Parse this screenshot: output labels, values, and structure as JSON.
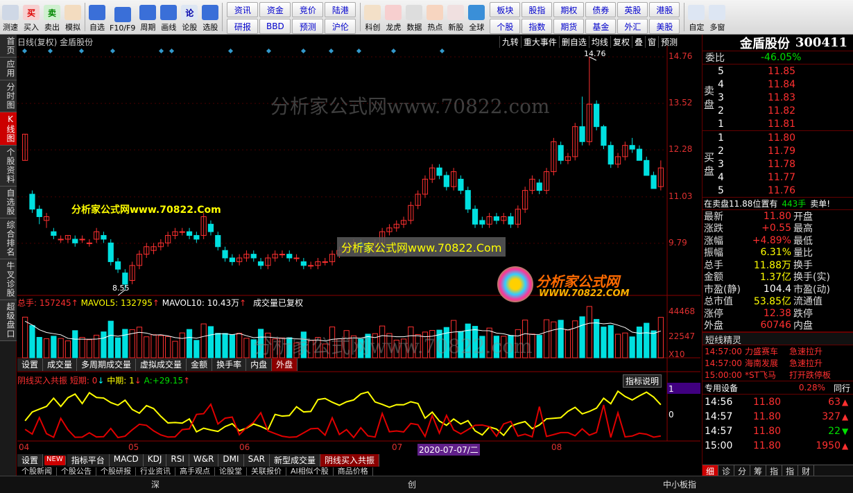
{
  "toolbar": {
    "left_buttons": [
      {
        "label": "测速",
        "icon": "clock-icon"
      },
      {
        "label": "买入",
        "icon": "buy-icon",
        "glyph": "买"
      },
      {
        "label": "卖出",
        "icon": "sell-icon",
        "glyph": "卖"
      },
      {
        "label": "模拟",
        "icon": "hammer-icon"
      },
      {
        "label": "自选",
        "icon": "star-icon"
      },
      {
        "label": "F10/F9",
        "icon": "f10-icon"
      },
      {
        "label": "周期",
        "icon": "period-icon"
      },
      {
        "label": "画线",
        "icon": "pen-icon"
      },
      {
        "label": "论股",
        "icon": "discuss-icon",
        "glyph": "论"
      },
      {
        "label": "选股",
        "icon": "select-stock-icon"
      }
    ],
    "grid1": [
      "资讯",
      "资金",
      "竞价",
      "陆港",
      "研报",
      "BBD",
      "预测",
      "沪伦"
    ],
    "mid_buttons": [
      {
        "label": "科创",
        "icon": "science-icon"
      },
      {
        "label": "龙虎",
        "icon": "dragon-tiger-icon"
      },
      {
        "label": "数据",
        "icon": "pe-data-icon"
      },
      {
        "label": "热点",
        "icon": "hot-icon"
      },
      {
        "label": "新股",
        "icon": "new-stock-icon"
      },
      {
        "label": "全球",
        "icon": "globe-icon"
      }
    ],
    "grid2": [
      "板块",
      "股指",
      "期权",
      "债券",
      "英股",
      "港股",
      "个股",
      "指数",
      "期货",
      "基金",
      "外汇",
      "美股"
    ],
    "right_buttons": [
      {
        "label": "自定",
        "icon": "custom-icon"
      },
      {
        "label": "多窗",
        "icon": "multi-window-icon"
      }
    ]
  },
  "left_tabs": [
    {
      "label": "首页",
      "active": false
    },
    {
      "label": "应用",
      "active": false
    },
    {
      "label": "分时图",
      "active": false
    },
    {
      "label": "K线图",
      "active": true
    },
    {
      "label": "个股资料",
      "active": false
    },
    {
      "label": "自选股",
      "active": false
    },
    {
      "label": "综合排名",
      "active": false
    },
    {
      "label": "牛叉诊股",
      "active": false
    },
    {
      "label": "超级盘口",
      "active": false
    }
  ],
  "main": {
    "header": "日线(复权) 金盾股份",
    "tools": [
      "九转",
      "重大事件",
      "删自选",
      "均线",
      "复权",
      "叠",
      "窗",
      "预测"
    ],
    "y_ticks": [
      "14.76",
      "13.52",
      "12.28",
      "11.03",
      "9.79"
    ],
    "high_label": "14.76",
    "low_label": "8.55",
    "watermark": "分析家公式网www.70822.com",
    "yellow_tag": "分析家公式网www.70822.Com",
    "box_tag": "分析家公式网www.70822.Com",
    "logo_cn": "分析家公式网",
    "logo_en": "WWW.70822.COM"
  },
  "volume": {
    "header_total_label": "总手:",
    "header_total": "157245",
    "header_ma5_label": "MAVOL5:",
    "header_ma5": "132795",
    "header_ma10_label": "MAVOL10:",
    "header_ma10": "10.43万",
    "header_note": "成交量已复权",
    "y_ticks": [
      "44468",
      "22547",
      "X10"
    ],
    "tabs": [
      "设置",
      "成交量",
      "多周期成交量",
      "虚拟成交量",
      "金额",
      "换手率",
      "内盘",
      "外盘"
    ],
    "active_tab": "外盘"
  },
  "indicator": {
    "name": "阴线买入共振",
    "short_label": "短期:",
    "short_val": "0",
    "mid_label": "中期:",
    "mid_val": "1",
    "a_label": "A:",
    "a_val": "+29.15",
    "btn": "指标说明",
    "y_ticks": [
      "1",
      "0"
    ]
  },
  "dates": {
    "labels": [
      "04",
      "05",
      "06",
      "07",
      "08"
    ],
    "cursor": "2020-07-07/二"
  },
  "bottom_tabs": [
    "设置",
    "指标平台",
    "MACD",
    "KDJ",
    "RSI",
    "W&R",
    "DMI",
    "SAR",
    "新型成交量",
    "阴线买入共振"
  ],
  "bottom_tabs_new_badge": "NEW",
  "news_tabs": [
    "个股新闻",
    "个股公告",
    "个股研报",
    "行业资讯",
    "高手观点",
    "论股堂",
    "关联报价",
    "AI相似个股",
    "商品价格"
  ],
  "status": {
    "left": "深",
    "mid": "创",
    "right": "中小板指"
  },
  "stock": {
    "name": "金盾股份",
    "code": "300411",
    "weibi_label": "委比",
    "weibi": "-46.05%",
    "sell_label": "卖盘",
    "buy_label": "买盘",
    "asks": [
      {
        "n": "5",
        "p": "11.85"
      },
      {
        "n": "4",
        "p": "11.84"
      },
      {
        "n": "3",
        "p": "11.83"
      },
      {
        "n": "2",
        "p": "11.82"
      },
      {
        "n": "1",
        "p": "11.81"
      }
    ],
    "bids": [
      {
        "n": "1",
        "p": "11.80"
      },
      {
        "n": "2",
        "p": "11.79"
      },
      {
        "n": "3",
        "p": "11.78"
      },
      {
        "n": "4",
        "p": "11.77"
      },
      {
        "n": "5",
        "p": "11.76"
      }
    ],
    "trade_note_prefix": "在卖盘11.88位置有",
    "trade_note_vol": "443手",
    "trade_note_suffix": "卖单!",
    "quotes": [
      {
        "k": "最新",
        "v": "11.80",
        "k2": "开盘",
        "c": "red"
      },
      {
        "k": "涨跌",
        "v": "+0.55",
        "k2": "最高",
        "c": "red"
      },
      {
        "k": "涨幅",
        "v": "+4.89%",
        "k2": "最低",
        "c": "red"
      },
      {
        "k": "振幅",
        "v": "6.31%",
        "k2": "量比",
        "c": "yel"
      },
      {
        "k": "总手",
        "v": "11.88万",
        "k2": "换手",
        "c": "yel"
      },
      {
        "k": "金额",
        "v": "1.37亿",
        "k2": "换手(实)",
        "c": "yel"
      },
      {
        "k": "市盈(静)",
        "v": "104.4",
        "k2": "市盈(动)",
        "c": "wht"
      },
      {
        "k": "总市值",
        "v": "53.85亿",
        "k2": "流通值",
        "c": "yel"
      },
      {
        "k": "涨停",
        "v": "12.38",
        "k2": "跌停",
        "c": "red"
      },
      {
        "k": "外盘",
        "v": "60746",
        "k2": "内盘",
        "c": "red"
      }
    ],
    "sprite_title": "短线精灵",
    "sprites": [
      {
        "t": "14:57:00",
        "n": "力盛赛车",
        "e": "急速拉升"
      },
      {
        "t": "14:57:00",
        "n": "海南发展",
        "e": "急速拉升"
      },
      {
        "t": "15:00:00",
        "n": "*ST飞马",
        "e": "打开跌停板"
      }
    ],
    "device_label": "专用设备",
    "device_pct": "0.28%",
    "device_more": "同行",
    "deals": [
      {
        "t": "14:56",
        "p": "11.80",
        "v": "63",
        "dir": "up"
      },
      {
        "t": "14:57",
        "p": "11.80",
        "v": "327",
        "dir": "up"
      },
      {
        "t": "14:57",
        "p": "11.80",
        "v": "22",
        "dir": "down"
      },
      {
        "t": "15:00",
        "p": "11.80",
        "v": "1950",
        "dir": "up"
      }
    ],
    "bottom_tabs": [
      "细",
      "诊",
      "分",
      "筹",
      "指",
      "指",
      "财"
    ]
  },
  "colors": {
    "up": "#ff3030",
    "down": "#00e0e0",
    "ma": "#ffffff",
    "yellow": "#ffff00",
    "bg": "#000000"
  },
  "chart_data": {
    "type": "candlestick",
    "title": "日线(复权) 金盾股份",
    "price_range": [
      8.55,
      14.76
    ],
    "candles": [
      [
        12.0,
        12.7,
        12.0,
        12.7
      ],
      [
        11.1,
        11.2,
        10.6,
        10.7
      ],
      [
        10.7,
        10.8,
        10.3,
        10.5
      ],
      [
        10.4,
        10.6,
        10.2,
        10.5
      ],
      [
        10.1,
        10.2,
        9.9,
        10.0
      ],
      [
        9.9,
        10.0,
        9.8,
        9.9
      ],
      [
        9.9,
        10.0,
        9.8,
        10.0
      ],
      [
        9.9,
        10.0,
        9.7,
        9.8
      ],
      [
        9.9,
        10.0,
        9.8,
        9.9
      ],
      [
        9.8,
        9.9,
        9.7,
        9.8
      ],
      [
        9.9,
        10.2,
        9.8,
        10.1
      ],
      [
        10.0,
        10.1,
        9.8,
        9.9
      ],
      [
        9.8,
        9.9,
        9.2,
        9.3
      ],
      [
        9.3,
        9.4,
        9.0,
        9.1
      ],
      [
        9.0,
        9.1,
        8.55,
        8.7
      ],
      [
        8.8,
        9.3,
        8.7,
        9.2
      ],
      [
        9.2,
        9.6,
        9.1,
        9.5
      ],
      [
        9.5,
        9.8,
        9.4,
        9.7
      ],
      [
        9.6,
        9.8,
        9.5,
        9.7
      ],
      [
        9.7,
        9.9,
        9.6,
        9.8
      ],
      [
        9.8,
        10.1,
        9.7,
        10.0
      ],
      [
        10.0,
        10.2,
        9.9,
        10.1
      ],
      [
        10.1,
        10.2,
        10.0,
        10.1
      ],
      [
        10.1,
        10.2,
        9.9,
        10.0
      ],
      [
        10.0,
        10.1,
        9.8,
        9.9
      ],
      [
        10.0,
        10.6,
        9.9,
        10.5
      ],
      [
        10.3,
        10.4,
        10.0,
        10.1
      ],
      [
        10.0,
        10.1,
        9.6,
        9.7
      ],
      [
        9.6,
        9.7,
        9.3,
        9.4
      ],
      [
        9.4,
        9.5,
        9.2,
        9.3
      ],
      [
        9.3,
        9.5,
        9.2,
        9.4
      ],
      [
        9.4,
        9.6,
        9.3,
        9.5
      ],
      [
        9.5,
        9.6,
        9.3,
        9.4
      ],
      [
        9.3,
        9.4,
        9.1,
        9.2
      ],
      [
        9.2,
        9.5,
        9.1,
        9.4
      ],
      [
        9.4,
        9.6,
        9.3,
        9.5
      ],
      [
        9.5,
        9.6,
        9.4,
        9.5
      ],
      [
        9.5,
        9.6,
        9.3,
        9.4
      ],
      [
        9.4,
        9.5,
        9.3,
        9.4
      ],
      [
        9.3,
        9.4,
        9.1,
        9.2
      ],
      [
        9.2,
        9.3,
        9.1,
        9.2
      ],
      [
        9.2,
        9.4,
        9.1,
        9.3
      ],
      [
        9.3,
        9.4,
        9.2,
        9.3
      ],
      [
        9.3,
        9.6,
        9.2,
        9.5
      ],
      [
        9.5,
        9.7,
        9.4,
        9.6
      ],
      [
        9.6,
        9.8,
        9.5,
        9.7
      ],
      [
        9.7,
        9.9,
        9.6,
        9.8
      ],
      [
        9.8,
        9.9,
        9.6,
        9.7
      ],
      [
        9.7,
        9.8,
        9.5,
        9.6
      ],
      [
        9.6,
        9.9,
        9.5,
        9.8
      ],
      [
        9.8,
        10.2,
        9.7,
        10.1
      ],
      [
        10.1,
        10.3,
        10.0,
        10.2
      ],
      [
        10.2,
        10.4,
        10.1,
        10.3
      ],
      [
        10.3,
        10.5,
        10.2,
        10.4
      ],
      [
        10.4,
        10.9,
        10.3,
        10.8
      ],
      [
        10.8,
        11.2,
        10.7,
        11.1
      ],
      [
        11.1,
        11.6,
        11.0,
        11.5
      ],
      [
        11.5,
        11.9,
        11.4,
        11.8
      ],
      [
        11.8,
        11.9,
        11.5,
        11.6
      ],
      [
        11.6,
        11.7,
        11.2,
        11.3
      ],
      [
        11.3,
        11.8,
        11.2,
        11.7
      ],
      [
        11.5,
        11.6,
        11.1,
        11.2
      ],
      [
        11.2,
        11.3,
        10.6,
        10.7
      ],
      [
        10.7,
        10.8,
        10.2,
        10.3
      ],
      [
        10.4,
        10.5,
        10.2,
        10.3
      ],
      [
        10.3,
        10.6,
        10.2,
        10.5
      ],
      [
        10.5,
        10.6,
        10.3,
        10.4
      ],
      [
        10.4,
        10.6,
        10.3,
        10.5
      ],
      [
        10.5,
        10.6,
        10.2,
        10.3
      ],
      [
        10.3,
        10.8,
        10.2,
        10.7
      ],
      [
        10.7,
        11.3,
        10.6,
        11.2
      ],
      [
        11.2,
        11.6,
        11.1,
        11.5
      ],
      [
        11.4,
        11.5,
        11.1,
        11.2
      ],
      [
        11.2,
        11.8,
        11.1,
        11.7
      ],
      [
        11.7,
        12.6,
        11.6,
        12.5
      ],
      [
        12.4,
        12.5,
        11.9,
        12.0
      ],
      [
        12.0,
        12.2,
        11.9,
        12.1
      ],
      [
        12.1,
        13.0,
        12.0,
        12.9
      ],
      [
        12.9,
        13.7,
        12.4,
        12.5
      ],
      [
        12.5,
        14.76,
        12.4,
        13.5
      ],
      [
        13.5,
        13.6,
        12.8,
        12.9
      ],
      [
        12.9,
        12.95,
        12.3,
        12.4
      ],
      [
        12.4,
        12.5,
        11.8,
        11.9
      ],
      [
        11.9,
        12.2,
        11.8,
        12.1
      ],
      [
        12.1,
        12.5,
        12.0,
        12.4
      ],
      [
        12.4,
        12.6,
        12.2,
        12.3
      ],
      [
        12.3,
        12.4,
        12.0,
        12.0
      ],
      [
        12.0,
        12.1,
        11.6,
        11.6
      ],
      [
        11.6,
        11.7,
        11.3,
        11.25
      ],
      [
        11.3,
        12.0,
        11.2,
        11.8
      ]
    ],
    "volume_ticks": [
      "44468",
      "22547"
    ]
  }
}
